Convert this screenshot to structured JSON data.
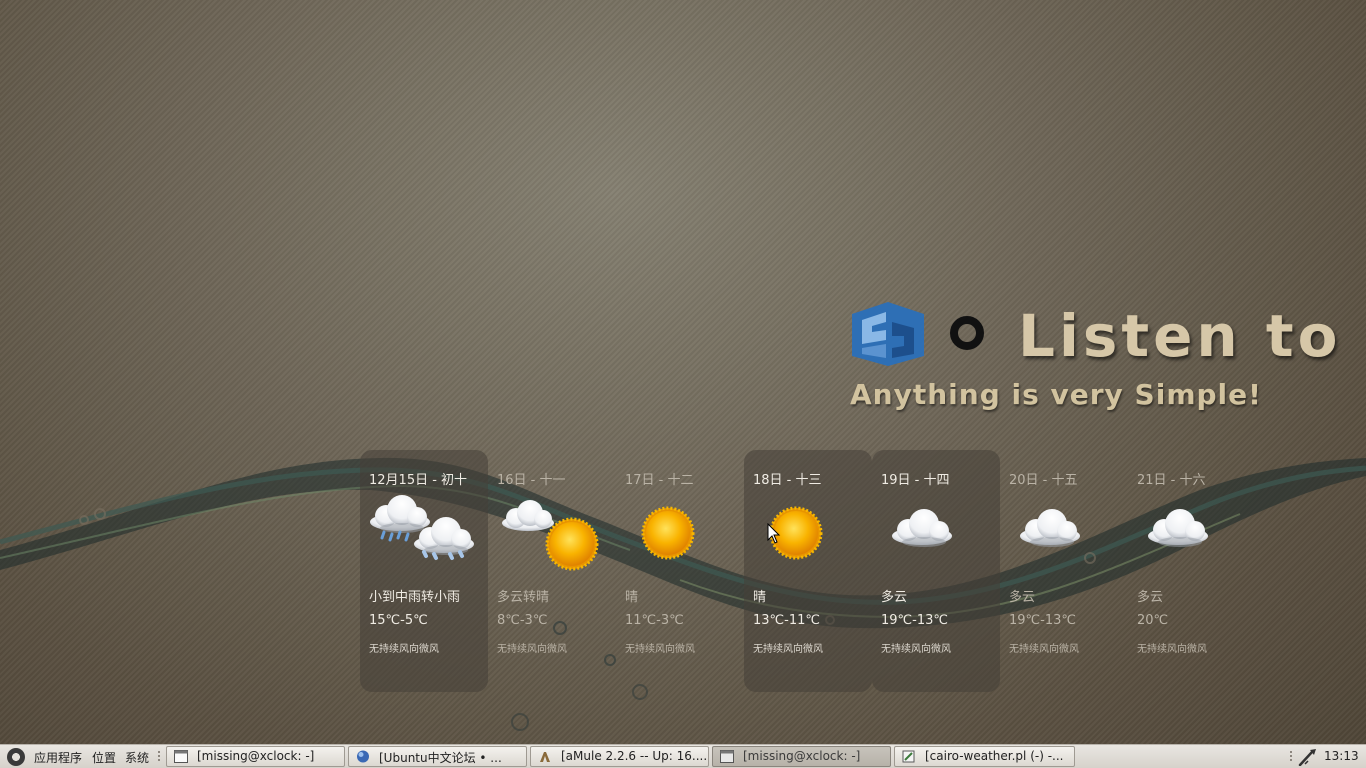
{
  "desktop": {
    "brand": {
      "title": "Listen to k",
      "slogan": "Anything is very Simple!"
    }
  },
  "weather": {
    "days": [
      {
        "date": "12月15日 - 初十",
        "condition": "小到中雨转小雨",
        "temp": "15℃-5℃",
        "wind": "无持续风向微风",
        "icon": "rain-snow-icon",
        "highlighted": true
      },
      {
        "date": "16日 - 十一",
        "condition": "多云转晴",
        "temp": "8℃-3℃",
        "wind": "无持续风向微风",
        "icon": "cloud-sun-icon",
        "highlighted": false
      },
      {
        "date": "17日 - 十二",
        "condition": "晴",
        "temp": "11℃-3℃",
        "wind": "无持续风向微风",
        "icon": "sun-icon",
        "highlighted": false
      },
      {
        "date": "18日 - 十三",
        "condition": "晴",
        "temp": "13℃-11℃",
        "wind": "无持续风向微风",
        "icon": "sun-icon",
        "highlighted": true
      },
      {
        "date": "19日 - 十四",
        "condition": "多云",
        "temp": "19℃-13℃",
        "wind": "无持续风向微风",
        "icon": "cloud-icon",
        "highlighted": true
      },
      {
        "date": "20日 - 十五",
        "condition": "多云",
        "temp": "19℃-13℃",
        "wind": "无持续风向微风",
        "icon": "cloud-icon",
        "highlighted": false
      },
      {
        "date": "21日 - 十六",
        "condition": "多云",
        "temp": "20℃",
        "wind": "无持续风向微风",
        "icon": "cloud-icon",
        "highlighted": false
      }
    ]
  },
  "taskbar": {
    "menus": {
      "applications": "应用程序",
      "places": "位置",
      "system": "系统"
    },
    "tasks": [
      {
        "label": "[missing@xclock: -]",
        "icon": "terminal-icon",
        "active": false
      },
      {
        "label": "[Ubuntu中文论坛 • ...",
        "icon": "browser-icon",
        "active": false
      },
      {
        "label": "[aMule 2.2.6 -- Up: 16....",
        "icon": "amule-icon",
        "active": false
      },
      {
        "label": "[missing@xclock: -]",
        "icon": "terminal-icon",
        "active": true
      },
      {
        "label": "[cairo-weather.pl (-) -...",
        "icon": "editor-icon",
        "active": false
      }
    ],
    "clock": "13:13"
  },
  "colors": {
    "taskbar_bg": "#dcd8d1",
    "sun": "#f5a000",
    "brand_text": "#d6c7a8",
    "logo_blue": "#2e6fb5"
  }
}
